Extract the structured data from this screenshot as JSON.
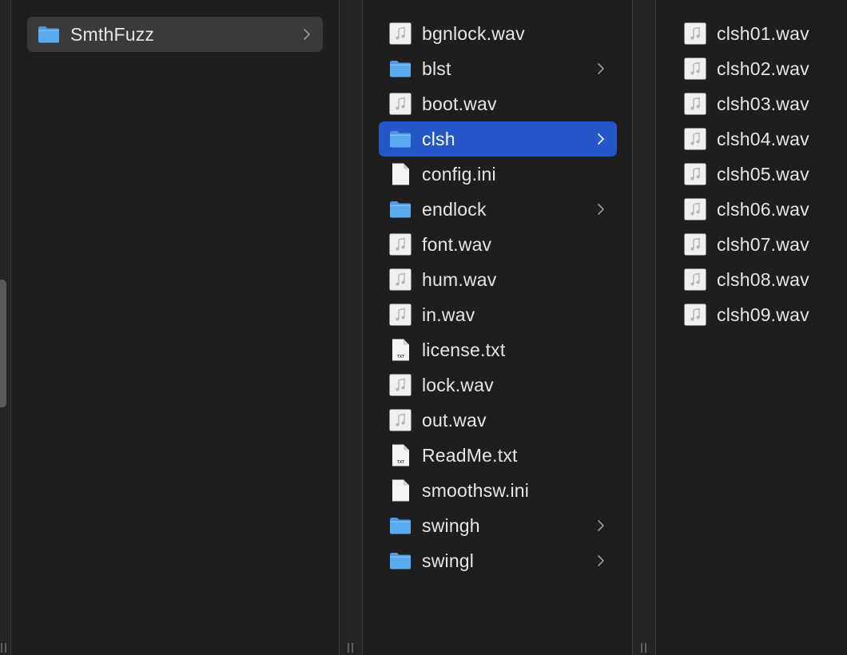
{
  "columns": [
    {
      "items": [
        {
          "label": "SmthFuzz",
          "type": "folder",
          "selected": "gray"
        }
      ]
    },
    {
      "items": [
        {
          "label": "bgnlock.wav",
          "type": "audio"
        },
        {
          "label": "blst",
          "type": "folder"
        },
        {
          "label": "boot.wav",
          "type": "audio"
        },
        {
          "label": "clsh",
          "type": "folder",
          "selected": "blue"
        },
        {
          "label": "config.ini",
          "type": "doc"
        },
        {
          "label": "endlock",
          "type": "folder"
        },
        {
          "label": "font.wav",
          "type": "audio"
        },
        {
          "label": "hum.wav",
          "type": "audio"
        },
        {
          "label": "in.wav",
          "type": "audio"
        },
        {
          "label": "license.txt",
          "type": "txt"
        },
        {
          "label": "lock.wav",
          "type": "audio"
        },
        {
          "label": "out.wav",
          "type": "audio"
        },
        {
          "label": "ReadMe.txt",
          "type": "txt"
        },
        {
          "label": "smoothsw.ini",
          "type": "doc"
        },
        {
          "label": "swingh",
          "type": "folder"
        },
        {
          "label": "swingl",
          "type": "folder"
        }
      ]
    },
    {
      "items": [
        {
          "label": "clsh01.wav",
          "type": "audio"
        },
        {
          "label": "clsh02.wav",
          "type": "audio"
        },
        {
          "label": "clsh03.wav",
          "type": "audio"
        },
        {
          "label": "clsh04.wav",
          "type": "audio"
        },
        {
          "label": "clsh05.wav",
          "type": "audio"
        },
        {
          "label": "clsh06.wav",
          "type": "audio"
        },
        {
          "label": "clsh07.wav",
          "type": "audio"
        },
        {
          "label": "clsh08.wav",
          "type": "audio"
        },
        {
          "label": "clsh09.wav",
          "type": "audio"
        }
      ]
    }
  ],
  "icons": {
    "folder": "folder-icon",
    "audio": "audio-file-icon",
    "doc": "document-icon",
    "txt": "text-file-icon",
    "chevron": "chevron-right-icon",
    "resize": "column-resize-handle-icon"
  },
  "colors": {
    "background": "#1e1e1e",
    "selection_active": "#2557c9",
    "selection_inactive": "#3a3a3c",
    "folder_blue": "#5aaaf0",
    "text": "#e6e6e6"
  }
}
